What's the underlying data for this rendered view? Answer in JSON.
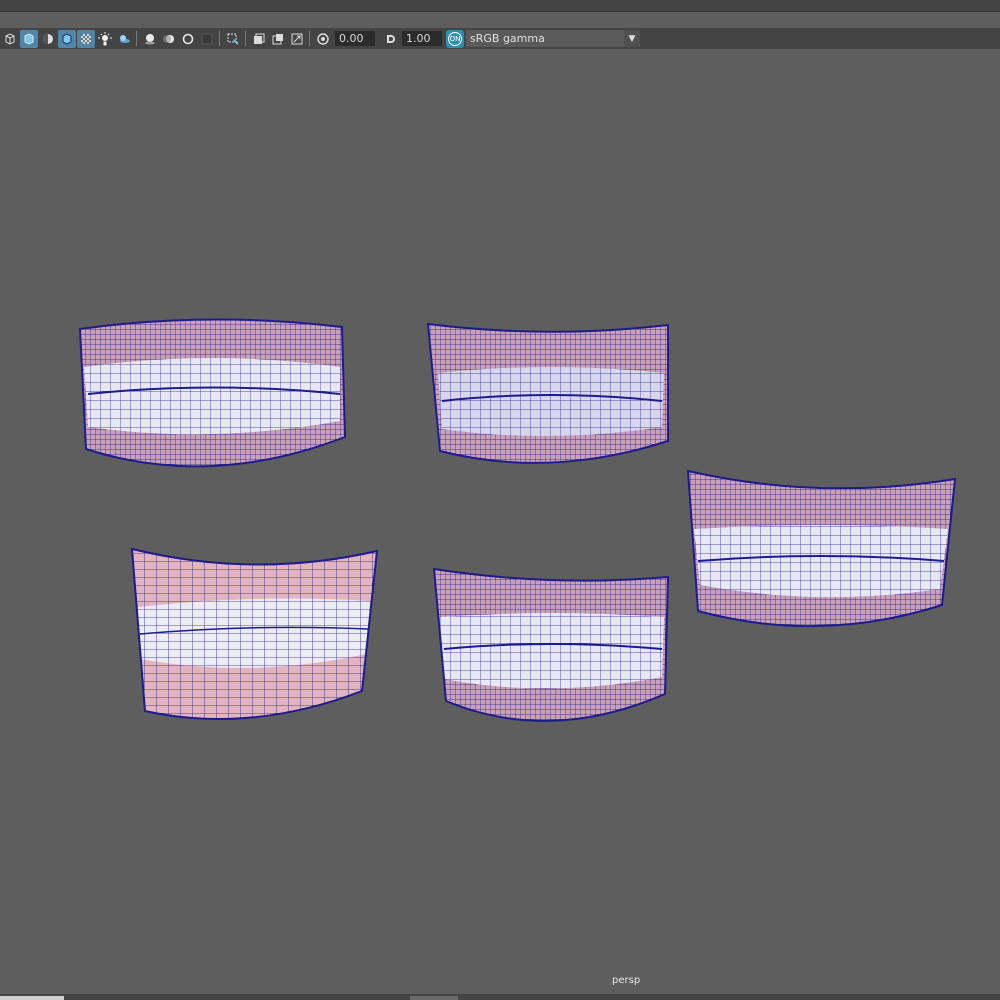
{
  "toolbar": {
    "exposure_value": "0.00",
    "gamma_value": "1.00",
    "color_management_badge": "ON",
    "color_space": "sRGB gamma"
  },
  "viewport": {
    "camera_label": "persp",
    "background_color": "#5e5e5e",
    "wire_color": "#1e1b8c",
    "gum_color": "#c9a0b6",
    "tooth_color": "#e8e8f4"
  }
}
